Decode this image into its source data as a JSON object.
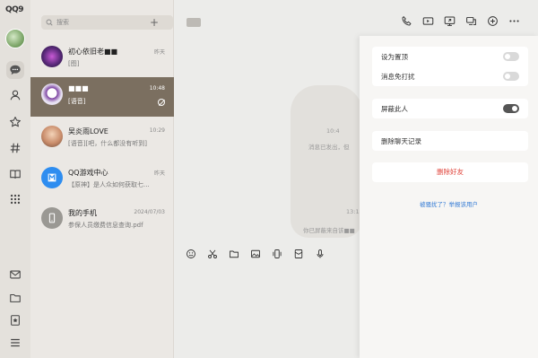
{
  "app": {
    "logo": "QQ9"
  },
  "rail": {
    "items": [
      "chat-icon",
      "contacts-icon",
      "star-icon",
      "hashtag-icon",
      "book-icon",
      "apps-grid-icon"
    ],
    "bottom_items": [
      "mail-icon",
      "folder-icon",
      "bookmark-icon",
      "menu-icon"
    ]
  },
  "search": {
    "placeholder": "搜索"
  },
  "conversations": [
    {
      "name": "初心依旧老■■",
      "time": "昨天",
      "message": "[图]"
    },
    {
      "name": "■■■",
      "time": "10:48",
      "message": "[语音]"
    },
    {
      "name": "吴炎雨LOVE",
      "time": "10:29",
      "message": "[语音][吧，什么都没有听到]"
    },
    {
      "name": "QQ游戏中心",
      "time": "昨天",
      "message": "【原神】是人众如何获取七..."
    },
    {
      "name": "我的手机",
      "time": "2024/07/03",
      "message": "参保人员缴费信息查询.pdf"
    }
  ],
  "chat": {
    "system_lines": [
      "10:4",
      "消息已发出，但",
      "13:1",
      "你已屏蔽来自该■■"
    ]
  },
  "settings": {
    "pin_label": "设为置顶",
    "mute_label": "消息免打扰",
    "block_label": "屏蔽此人",
    "clear_history": "删除聊天记录",
    "delete_friend": "删除好友",
    "report_link": "被骚扰了？举报该用户",
    "pin_on": false,
    "mute_on": false,
    "block_on": true
  },
  "colors": {
    "danger": "#e0443b",
    "link": "#3a7fd6",
    "selected_row": "#7b6f60"
  }
}
